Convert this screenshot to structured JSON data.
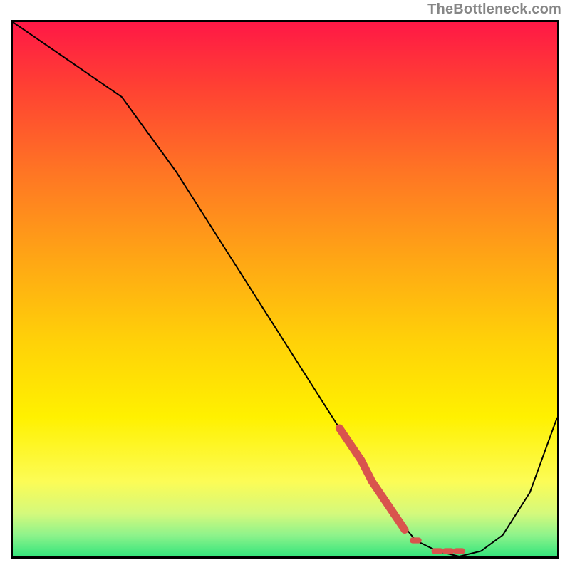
{
  "attribution": "TheBottleneck.com",
  "chart_data": {
    "type": "line",
    "title": "",
    "xlabel": "",
    "ylabel": "",
    "xlim": [
      0,
      100
    ],
    "ylim": [
      0,
      100
    ],
    "series": [
      {
        "name": "bottleneck-curve",
        "x": [
          0,
          10,
          20,
          30,
          40,
          50,
          60,
          65,
          70,
          74,
          78,
          82,
          86,
          90,
          95,
          100
        ],
        "y": [
          100,
          93,
          86,
          72,
          56,
          40,
          24,
          16,
          8,
          3,
          1,
          0,
          1,
          4,
          12,
          26
        ],
        "color": "#000000"
      },
      {
        "name": "highlight-dots",
        "x": [
          60,
          62,
          64,
          66,
          68,
          70,
          72,
          74,
          78,
          80,
          82
        ],
        "y": [
          24,
          21,
          18,
          14,
          11,
          8,
          5,
          3,
          1,
          1,
          1
        ],
        "color": "#d9544d"
      }
    ]
  }
}
